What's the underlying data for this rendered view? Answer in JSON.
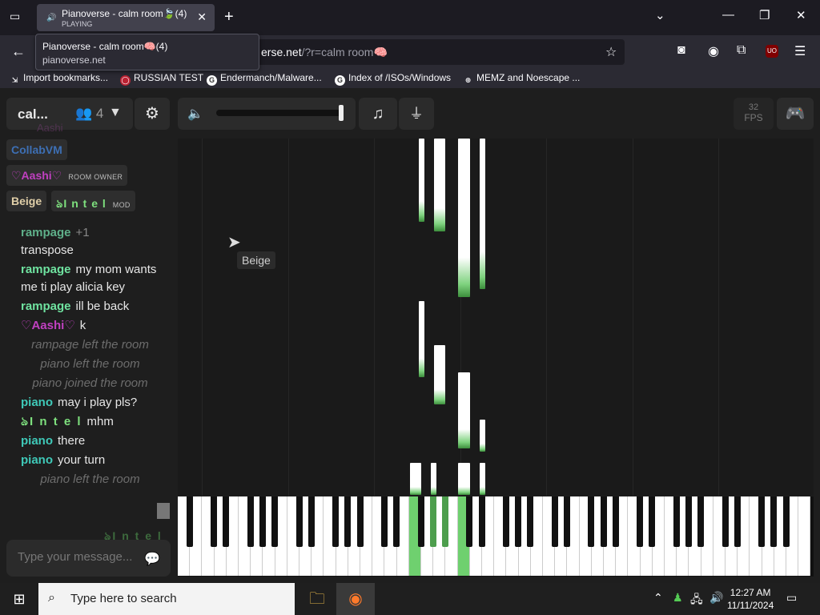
{
  "browser": {
    "tab": {
      "title": "Pianoverse - calm room🍃(4)",
      "status": "PLAYING"
    },
    "tooltip": {
      "title": "Pianoverse - calm room🧠(4)",
      "domain": "pianoverse.net"
    },
    "url": {
      "host": "erse.net",
      "path": "/?r=calm room🧠"
    },
    "bookmarks": [
      {
        "label": "Import bookmarks..."
      },
      {
        "label": "RUSSIAN TEST"
      },
      {
        "label": "Endermanch/Malware..."
      },
      {
        "label": "Index of /ISOs/Windows"
      },
      {
        "label": "MEMZ and Noescape ..."
      }
    ]
  },
  "toolbar": {
    "room_name": "cal...",
    "user_count": "4",
    "fps_value": "32",
    "fps_label": "FPS"
  },
  "users": [
    {
      "name": "CollabVM",
      "color": "#3d6fb4",
      "badge": ""
    },
    {
      "name": "♡Aashi♡",
      "color": "#c040c0",
      "badge": "ROOM OWNER"
    },
    {
      "name": "Beige",
      "color": "#e0cfa8",
      "badge": ""
    },
    {
      "name": "ঌI n t e l",
      "color": "#7ee07e",
      "badge": "MOD"
    }
  ],
  "chat": [
    {
      "nick": "rampage",
      "text": "+1",
      "color": "#5fb08a",
      "dim": true
    },
    {
      "nick": "",
      "text": "transpose",
      "color": ""
    },
    {
      "nick": "rampage",
      "text": "my mom wants me ti play alicia key",
      "color": "#6fe3a0"
    },
    {
      "nick": "rampage",
      "text": "ill be back",
      "color": "#6fe3a0"
    },
    {
      "nick": "♡Aashi♡",
      "text": "k",
      "color": "#c040c0"
    },
    {
      "system": "rampage left the room"
    },
    {
      "system": "piano left the room"
    },
    {
      "system": "piano joined the room"
    },
    {
      "nick": "piano",
      "text": "may i play pls?",
      "color": "#3fc9b8"
    },
    {
      "nick": "ঌI n t e l",
      "text": "mhm",
      "color": "#7ee07e"
    },
    {
      "nick": "piano",
      "text": "there",
      "color": "#3fc9b8"
    },
    {
      "nick": "piano",
      "text": "your turn",
      "color": "#3fc9b8"
    },
    {
      "system": "piano left the room"
    }
  ],
  "chat_input": {
    "placeholder": "Type your message..."
  },
  "cursor_label": "Beige",
  "ghost_names": {
    "top": "Aashi",
    "bottom": "ঌI n t e l"
  },
  "taskbar": {
    "search_placeholder": "Type here to search",
    "time": "12:27 AM",
    "date": "11/11/2024"
  },
  "icons": {
    "settings": "gear-icon",
    "volume": "speaker-icon",
    "music": "music-note-icon",
    "usb": "usb-icon",
    "discord": "discord-icon"
  }
}
